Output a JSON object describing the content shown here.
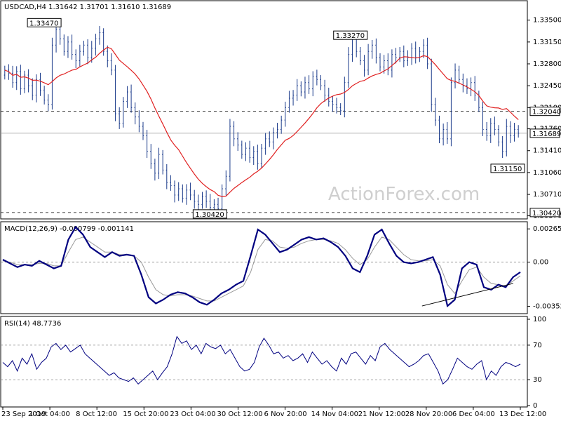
{
  "chart_data": [
    {
      "type": "candlestick",
      "panel": "price",
      "header": "USDCAD,H4  1.31642 1.31701 1.31610 1.31689",
      "y_ticks": [
        "1.33500",
        "1.33150",
        "1.32800",
        "1.32450",
        "1.32100",
        "1.31760",
        "1.31410",
        "1.31060",
        "1.30710",
        "1.30370"
      ],
      "ylim": [
        1.3034,
        1.3362
      ],
      "horizontal_levels": [
        {
          "label": "1.32040",
          "value": 1.3204,
          "style": "dashed"
        },
        {
          "label": "1.30420",
          "value": 1.3042,
          "style": "dashed"
        }
      ],
      "last_price": {
        "label": "1.31689",
        "value": 1.31689
      },
      "callouts": [
        {
          "label": "1.33470",
          "value": 1.3347,
          "x_date": "1 Oct 04:00"
        },
        {
          "label": "1.30420",
          "value": 1.3042,
          "x_date": "23 Oct 04:00"
        },
        {
          "label": "1.33270",
          "value": 1.3327,
          "x_date": "21 Nov 12:00"
        },
        {
          "label": "1.31150",
          "value": 1.3115,
          "x_date": "13 Dec 12:00"
        }
      ],
      "close_series": [
        1.327,
        1.3265,
        1.325,
        1.3268,
        1.324,
        1.3262,
        1.3245,
        1.323,
        1.3255,
        1.3238,
        1.3222,
        1.3215,
        1.331,
        1.3335,
        1.332,
        1.33,
        1.3315,
        1.3295,
        1.3285,
        1.33,
        1.331,
        1.329,
        1.3305,
        1.332,
        1.333,
        1.33,
        1.3285,
        1.327,
        1.32,
        1.3185,
        1.322,
        1.3235,
        1.321,
        1.3195,
        1.318,
        1.3165,
        1.314,
        1.312,
        1.3105,
        1.3135,
        1.311,
        1.309,
        1.3085,
        1.307,
        1.308,
        1.3065,
        1.3078,
        1.307,
        1.306,
        1.3055,
        1.3068,
        1.306,
        1.305,
        1.3055,
        1.3048,
        1.308,
        1.31,
        1.318,
        1.316,
        1.315,
        1.3135,
        1.3145,
        1.313,
        1.314,
        1.312,
        1.3145,
        1.316,
        1.3155,
        1.317,
        1.3175,
        1.319,
        1.321,
        1.3225,
        1.323,
        1.3245,
        1.3235,
        1.325,
        1.324,
        1.326,
        1.3255,
        1.3245,
        1.323,
        1.322,
        1.3215,
        1.321,
        1.3205,
        1.325,
        1.3295,
        1.332,
        1.33,
        1.3285,
        1.327,
        1.33,
        1.331,
        1.329,
        1.3275,
        1.3285,
        1.327,
        1.3295,
        1.329,
        1.33,
        1.3285,
        1.329,
        1.3305,
        1.329,
        1.33,
        1.331,
        1.328,
        1.3215,
        1.319,
        1.316,
        1.3175,
        1.316,
        1.325,
        1.327,
        1.3255,
        1.3245,
        1.324,
        1.325,
        1.323,
        1.321,
        1.3175,
        1.3165,
        1.3185,
        1.3175,
        1.3155,
        1.314,
        1.318,
        1.3165,
        1.3175,
        1.3169
      ],
      "moving_average_color": "#e02020",
      "candle_color": "#1a3a8a",
      "x_ticks": [
        "23 Sep 2019",
        "1 Oct 04:00",
        "8 Oct 12:00",
        "15 Oct 20:00",
        "23 Oct 04:00",
        "30 Oct 12:00",
        "6 Nov 20:00",
        "14 Nov 04:00",
        "21 Nov 12:00",
        "28 Nov 20:00",
        "6 Dec 04:00",
        "13 Dec 12:00"
      ]
    },
    {
      "type": "line",
      "panel": "macd",
      "header": "MACD(12,26,9) -0.000799 -0.001141",
      "y_ticks": [
        "0.002652",
        "0.00",
        "-0.003526"
      ],
      "ylim": [
        -0.004,
        0.003
      ],
      "series": [
        {
          "color": "#000080",
          "values": [
            0.0002,
            -0.0001,
            -0.0004,
            -0.0002,
            -0.0003,
            0.0001,
            -0.0002,
            -0.0005,
            -0.0003,
            0.0018,
            0.0028,
            0.0022,
            0.0012,
            0.0008,
            0.0004,
            0.0008,
            0.0005,
            0.0006,
            0.0005,
            -0.001,
            -0.0028,
            -0.0033,
            -0.003,
            -0.0026,
            -0.0024,
            -0.0025,
            -0.0028,
            -0.0032,
            -0.0034,
            -0.003,
            -0.0025,
            -0.0022,
            -0.0018,
            -0.0015,
            0.0005,
            0.0026,
            0.0022,
            0.0015,
            0.0008,
            0.001,
            0.0014,
            0.0018,
            0.002,
            0.0018,
            0.0019,
            0.0016,
            0.0012,
            0.0005,
            -0.0005,
            -0.0008,
            0.0005,
            0.0022,
            0.0026,
            0.0015,
            0.0005,
            0.0,
            -0.0001,
            0.0,
            0.0002,
            0.0004,
            -0.001,
            -0.0035,
            -0.003,
            -0.0005,
            0.0,
            -0.0002,
            -0.002,
            -0.0022,
            -0.0018,
            -0.002,
            -0.0012,
            -0.0008
          ]
        },
        {
          "color": "#999999",
          "values": [
            0.0001,
            0.0,
            -0.0002,
            -0.0002,
            -0.0002,
            -0.0001,
            -0.0001,
            -0.0003,
            -0.0003,
            0.0008,
            0.0018,
            0.002,
            0.0016,
            0.0012,
            0.0008,
            0.0008,
            0.0006,
            0.0006,
            0.0005,
            0.0,
            -0.0012,
            -0.0022,
            -0.0026,
            -0.0027,
            -0.0026,
            -0.0026,
            -0.0027,
            -0.0029,
            -0.0031,
            -0.0031,
            -0.0028,
            -0.0025,
            -0.0022,
            -0.0019,
            -0.0008,
            0.001,
            0.0018,
            0.0017,
            0.0012,
            0.0011,
            0.0012,
            0.0015,
            0.0017,
            0.0018,
            0.0018,
            0.0017,
            0.0015,
            0.001,
            0.0003,
            -0.0002,
            0.0002,
            0.0012,
            0.002,
            0.0018,
            0.0012,
            0.0006,
            0.0002,
            0.0001,
            0.0001,
            0.0002,
            -0.0003,
            -0.0018,
            -0.0025,
            -0.0015,
            -0.0006,
            -0.0004,
            -0.0012,
            -0.0017,
            -0.0018,
            -0.0019,
            -0.0015,
            -0.0011
          ]
        }
      ],
      "trendline": {
        "from": [
          0.81,
          -0.0035
        ],
        "to": [
          0.97,
          -0.0017
        ],
        "color": "#000000"
      }
    },
    {
      "type": "line",
      "panel": "rsi",
      "header": "RSI(14) 48.7736",
      "y_ticks": [
        "100",
        "70",
        "30",
        "0"
      ],
      "ylim": [
        0,
        100
      ],
      "levels": [
        70,
        30
      ],
      "series": [
        {
          "color": "#000080",
          "values": [
            50,
            45,
            52,
            40,
            55,
            48,
            60,
            42,
            50,
            55,
            68,
            72,
            65,
            70,
            62,
            66,
            70,
            60,
            55,
            50,
            45,
            40,
            35,
            38,
            32,
            30,
            28,
            32,
            25,
            30,
            35,
            40,
            30,
            38,
            45,
            60,
            80,
            72,
            75,
            65,
            70,
            60,
            72,
            68,
            66,
            70,
            60,
            65,
            55,
            45,
            40,
            42,
            50,
            68,
            78,
            70,
            60,
            62,
            55,
            58,
            52,
            55,
            60,
            50,
            62,
            55,
            48,
            52,
            45,
            40,
            55,
            48,
            60,
            62,
            55,
            48,
            58,
            52,
            68,
            72,
            65,
            60,
            55,
            50,
            45,
            48,
            52,
            58,
            60,
            50,
            40,
            25,
            30,
            42,
            55,
            50,
            45,
            42,
            48,
            52,
            30,
            40,
            35,
            45,
            50,
            48,
            45,
            48
          ]
        }
      ]
    }
  ],
  "watermark": "ActionForex.com",
  "colors": {
    "axis_label_text": "#000000",
    "grid_dashed": "#000000",
    "level_line": "#9e9e9e",
    "macd_zero": "#888888"
  }
}
